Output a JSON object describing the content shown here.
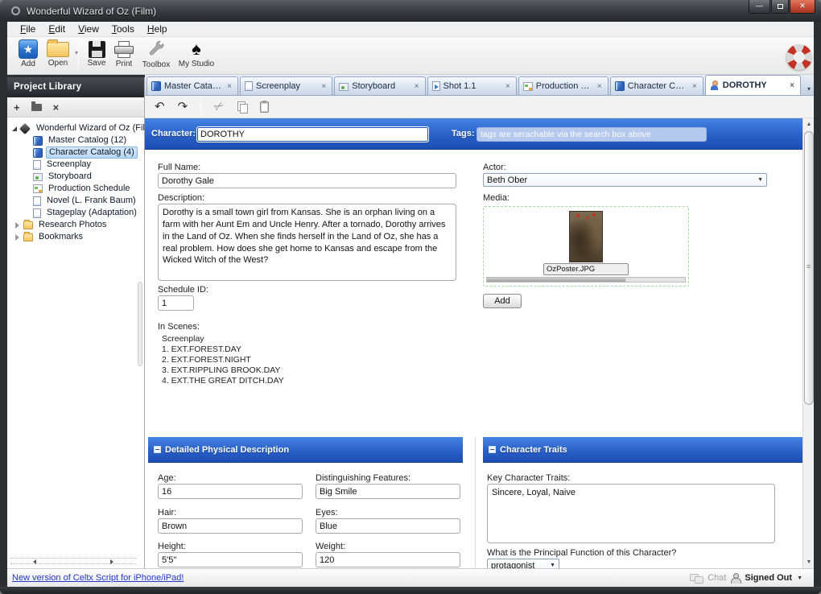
{
  "window": {
    "title": "Wonderful Wizard of Oz (Film)"
  },
  "menu": {
    "items": [
      {
        "label": "File"
      },
      {
        "label": "Edit"
      },
      {
        "label": "View"
      },
      {
        "label": "Tools"
      },
      {
        "label": "Help"
      }
    ]
  },
  "toolbar": {
    "add": "Add",
    "open": "Open",
    "save": "Save",
    "print": "Print",
    "toolbox": "Toolbox",
    "my_studio": "My Studio",
    "icons": [
      "add-icon",
      "open-folder-icon",
      "save-floppy-icon",
      "print-icon",
      "toolbox-wrench-icon",
      "my-studio-spade-icon",
      "help-lifepreserver-icon"
    ]
  },
  "tabs": [
    {
      "label": "Master Catalog",
      "icon": "catalog-book-icon",
      "close": "×",
      "active": false
    },
    {
      "label": "Screenplay",
      "icon": "screenplay-doc-icon",
      "close": "×",
      "active": false
    },
    {
      "label": "Storyboard",
      "icon": "storyboard-photo-icon",
      "close": "×",
      "active": false
    },
    {
      "label": "Shot 1.1",
      "icon": "shot-doc-icon",
      "close": "×",
      "active": false
    },
    {
      "label": "Production Sch...",
      "icon": "schedule-grid-icon",
      "close": "×",
      "active": false
    },
    {
      "label": "Character Catal...",
      "icon": "catalog-book-icon",
      "close": "×",
      "active": false
    },
    {
      "label": "DOROTHY",
      "icon": "character-person-icon",
      "close": "×",
      "active": true
    }
  ],
  "edit_toolbar": {
    "icons": [
      "undo-icon",
      "redo-icon",
      "cut-scissors-icon",
      "copy-icon",
      "paste-clipboard-icon"
    ],
    "undo_glyph": "↶",
    "redo_glyph": "↷",
    "cut_glyph": "✂"
  },
  "sidebar": {
    "title": "Project Library",
    "toolbar_icons": [
      "add-item-icon",
      "new-folder-icon",
      "delete-icon"
    ],
    "tree": {
      "root": {
        "label": "Wonderful Wizard of Oz (Fil...",
        "icon": "project-icon",
        "expanded": true
      },
      "items": [
        {
          "label": "Master Catalog (12)",
          "icon": "catalog-book-icon",
          "selected": false
        },
        {
          "label": "Character Catalog (4)",
          "icon": "catalog-book-icon",
          "selected": true
        },
        {
          "label": "Screenplay",
          "icon": "screenplay-doc-icon",
          "selected": false
        },
        {
          "label": "Storyboard",
          "icon": "storyboard-photo-icon",
          "selected": false
        },
        {
          "label": "Production Schedule",
          "icon": "schedule-grid-icon",
          "selected": false
        },
        {
          "label": "Novel (L. Frank Baum)",
          "icon": "novel-doc-icon",
          "selected": false
        },
        {
          "label": "Stageplay (Adaptation)",
          "icon": "screenplay-doc-icon",
          "selected": false
        },
        {
          "label": "Research Photos",
          "icon": "folder-icon",
          "selected": false,
          "collapsed": true
        },
        {
          "label": "Bookmarks",
          "icon": "folder-icon",
          "selected": false,
          "collapsed": true
        }
      ]
    }
  },
  "character_form": {
    "character_label": "Character:",
    "character_value": "DOROTHY",
    "tags_label": "Tags:",
    "tags_placeholder": "tags are serachable via the search box above",
    "full_name_label": "Full Name:",
    "full_name_value": "Dorothy Gale",
    "actor_label": "Actor:",
    "actor_value": "Beth Ober",
    "description_label": "Description:",
    "description_value": "Dorothy is a small town girl from Kansas. She is an orphan living on a farm with her Aunt Em and Uncle Henry. After a tornado, Dorothy arrives in the Land of Oz. When she finds herself in the Land of Oz, she has a real problem. How does she get home to Kansas and escape from the Wicked Witch of the West?",
    "media_label": "Media:",
    "media_file_name": "OzPoster.JPG",
    "add_media_button": "Add",
    "schedule_id_label": "Schedule ID:",
    "schedule_id_value": "1",
    "in_scenes_label": "In Scenes:",
    "in_scenes_group": "Screenplay",
    "in_scenes": [
      "1. EXT.FOREST.DAY",
      "2. EXT.FOREST.NIGHT",
      "3. EXT.RIPPLING BROOK.DAY",
      "4. EXT.THE GREAT DITCH.DAY"
    ]
  },
  "physical_section": {
    "title": "Detailed Physical Description",
    "fields": [
      {
        "label": "Age:",
        "value": "16"
      },
      {
        "label": "Distinguishing Features:",
        "value": "Big Smile"
      },
      {
        "label": "Hair:",
        "value": "Brown"
      },
      {
        "label": "Eyes:",
        "value": "Blue"
      },
      {
        "label": "Height:",
        "value": "5'5\""
      },
      {
        "label": "Weight:",
        "value": "120"
      }
    ]
  },
  "traits_section": {
    "title": "Character Traits",
    "key_traits_label": "Key Character Traits:",
    "key_traits_value": "Sincere, Loyal, Naive",
    "principal_function_label": "What is the Principal Function of this Character?",
    "principal_function_value": "protagonist"
  },
  "statusbar": {
    "update_link": "New version of Celtx Script for iPhone/iPad!",
    "chat_label": "Chat",
    "signed_out_label": "Signed Out"
  },
  "colors": {
    "accent_blue": "#2a60c8",
    "selection_blue": "#cbe2f7",
    "link_blue": "#2637cc",
    "close_red": "#c04a31",
    "media_border_green": "#a5d8a5"
  }
}
